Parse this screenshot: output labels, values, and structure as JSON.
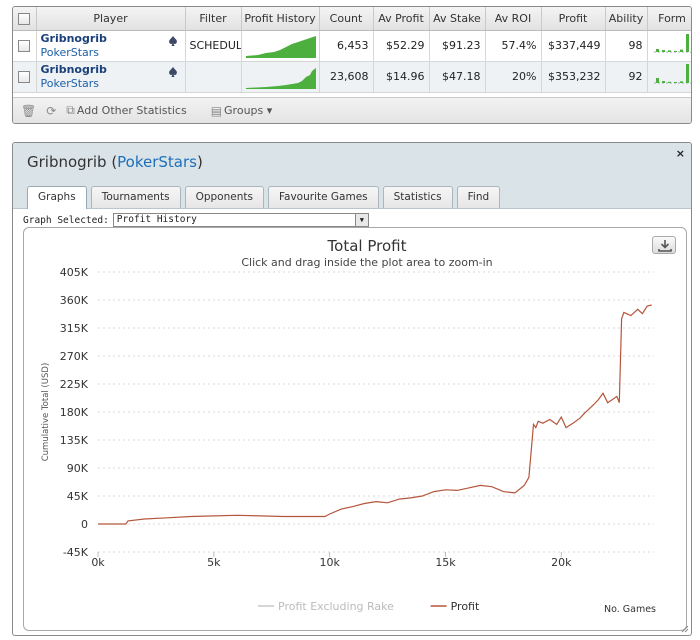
{
  "stats_table": {
    "headers": {
      "player": "Player",
      "filter": "Filter",
      "profit_history": "Profit History",
      "count": "Count",
      "av_profit": "Av Profit",
      "av_stake": "Av Stake",
      "av_roi": "Av ROI",
      "profit": "Profit",
      "ability": "Ability",
      "form": "Form"
    },
    "rows": [
      {
        "player": "Gribnogrib",
        "site": "PokerStars",
        "filter": "SCHEDUL",
        "count": "6,453",
        "av_profit": "$52.29",
        "av_stake": "$91.23",
        "av_roi": "57.4%",
        "profit": "$337,449",
        "ability": "98",
        "remove": "x",
        "form": [
          0.15,
          0.1,
          0.08,
          0.05,
          0.12,
          0.9,
          0.2
        ]
      },
      {
        "player": "Gribnogrib",
        "site": "PokerStars",
        "filter": "",
        "count": "23,608",
        "av_profit": "$14.96",
        "av_stake": "$47.18",
        "av_roi": "20%",
        "profit": "$353,232",
        "ability": "92",
        "remove": "x",
        "form": [
          0.25,
          0.1,
          0.06,
          0.05,
          0.08,
          0.95,
          0.15
        ]
      }
    ],
    "footer": {
      "add_stats_label": "Add Other Statistics",
      "groups_label": "Groups"
    }
  },
  "detail_window": {
    "player": "Gribnogrib",
    "site": "PokerStars",
    "close_label": "×",
    "tabs": [
      "Graphs",
      "Tournaments",
      "Opponents",
      "Favourite Games",
      "Statistics",
      "Find"
    ],
    "active_tab": 0,
    "graph_selected_label": "Graph Selected:",
    "graph_selected_value": "Profit History"
  },
  "colors": {
    "profit_line": "#b5563c",
    "excl_rake_line": "#c8c8c8",
    "spark_fill": "#4caf3e",
    "link": "#1e5fa8"
  },
  "chart_data": {
    "type": "line",
    "title": "Total Profit",
    "subtitle": "Click and drag inside the plot area to zoom-in",
    "xlabel": "No. Games",
    "ylabel": "Cumulative Total (USD)",
    "xlim": [
      0,
      24000
    ],
    "ylim": [
      -45000,
      405000
    ],
    "x_ticks": [
      "0k",
      "5k",
      "10k",
      "15k",
      "20k"
    ],
    "x_tick_values": [
      0,
      5000,
      10000,
      15000,
      20000
    ],
    "y_ticks": [
      "405K",
      "360K",
      "315K",
      "270K",
      "225K",
      "180K",
      "135K",
      "90K",
      "45K",
      "0",
      "-45K"
    ],
    "y_tick_values": [
      405000,
      360000,
      315000,
      270000,
      225000,
      180000,
      135000,
      90000,
      45000,
      0,
      -45000
    ],
    "grid": true,
    "legend": "bottom-center",
    "series": [
      {
        "name": "Profit Excluding Rake",
        "color": "#c8c8c8",
        "x": [],
        "y": []
      },
      {
        "name": "Profit",
        "color": "#b5563c",
        "x": [
          0,
          1200,
          1300,
          2000,
          3000,
          4000,
          5000,
          6000,
          7000,
          8000,
          9000,
          9800,
          10000,
          10500,
          11000,
          11500,
          12000,
          12500,
          13000,
          13500,
          14000,
          14500,
          15000,
          15500,
          16000,
          16500,
          17000,
          17500,
          18000,
          18400,
          18600,
          18800,
          18900,
          19000,
          19200,
          19500,
          19800,
          20000,
          20200,
          20500,
          20800,
          21000,
          21200,
          21400,
          21600,
          21800,
          22000,
          22200,
          22400,
          22500,
          22600,
          22700,
          23000,
          23300,
          23500,
          23700,
          23900
        ],
        "y": [
          0,
          0,
          5000,
          8000,
          10000,
          12000,
          13000,
          14000,
          13000,
          12000,
          12000,
          12000,
          16000,
          24000,
          28000,
          33000,
          36000,
          34000,
          40000,
          42000,
          45000,
          52000,
          55000,
          54000,
          58000,
          62000,
          60000,
          52000,
          50000,
          62000,
          75000,
          160000,
          155000,
          165000,
          162000,
          168000,
          160000,
          172000,
          155000,
          162000,
          170000,
          178000,
          185000,
          192000,
          200000,
          210000,
          195000,
          200000,
          205000,
          195000,
          330000,
          340000,
          335000,
          345000,
          338000,
          350000,
          352000
        ]
      }
    ]
  }
}
